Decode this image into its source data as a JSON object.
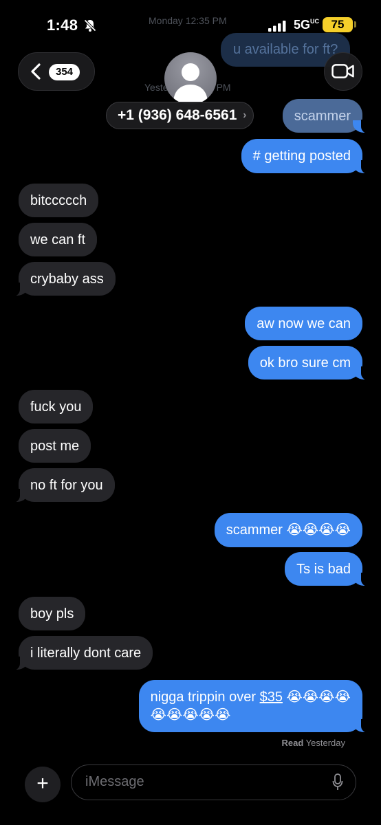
{
  "status_bar": {
    "time": "1:48",
    "network": "5G",
    "network_suffix": "UC",
    "battery": "75"
  },
  "background_faded": {
    "time_1": "Monday 12:35 PM",
    "time_2": "Yesterday 10:13 PM",
    "bubble": "u available for ft?"
  },
  "header": {
    "back_count": "354",
    "contact": "+1 (936) 648-6561",
    "contact_chevron": "›"
  },
  "messages": [
    {
      "dir": "out",
      "text": "scammer"
    },
    {
      "dir": "out",
      "text": "# getting posted"
    },
    {
      "dir": "in",
      "text": "bitccccch"
    },
    {
      "dir": "in",
      "text": "we can ft"
    },
    {
      "dir": "in",
      "text": "crybaby ass"
    },
    {
      "dir": "out",
      "text": "aw now we can"
    },
    {
      "dir": "out",
      "text": "ok bro sure cm"
    },
    {
      "dir": "in",
      "text": "fuck you"
    },
    {
      "dir": "in",
      "text": "post me"
    },
    {
      "dir": "in",
      "text": "no ft for you"
    },
    {
      "dir": "out",
      "text": "scammer 😭😭😭😭"
    },
    {
      "dir": "out",
      "text": "Ts is bad"
    },
    {
      "dir": "in",
      "text": "boy pls"
    },
    {
      "dir": "in",
      "text": "i literally dont care"
    },
    {
      "dir": "out",
      "text_before": "nigga trippin over ",
      "link": "$35",
      "text_after": " 😭😭😭😭",
      "line2": "😭😭😭😭😭"
    }
  ],
  "read_receipt": {
    "label": "Read",
    "when": "Yesterday"
  },
  "composer": {
    "placeholder": "iMessage",
    "plus": "+"
  },
  "icons": [
    "bell-slash-icon",
    "signal-icon",
    "battery-icon",
    "chevron-left-icon",
    "person-icon",
    "video-icon",
    "plus-icon",
    "mic-icon"
  ],
  "colors": {
    "outgoing": "#3d87f0",
    "incoming": "#26262a",
    "battery": "#f5cf2a"
  }
}
